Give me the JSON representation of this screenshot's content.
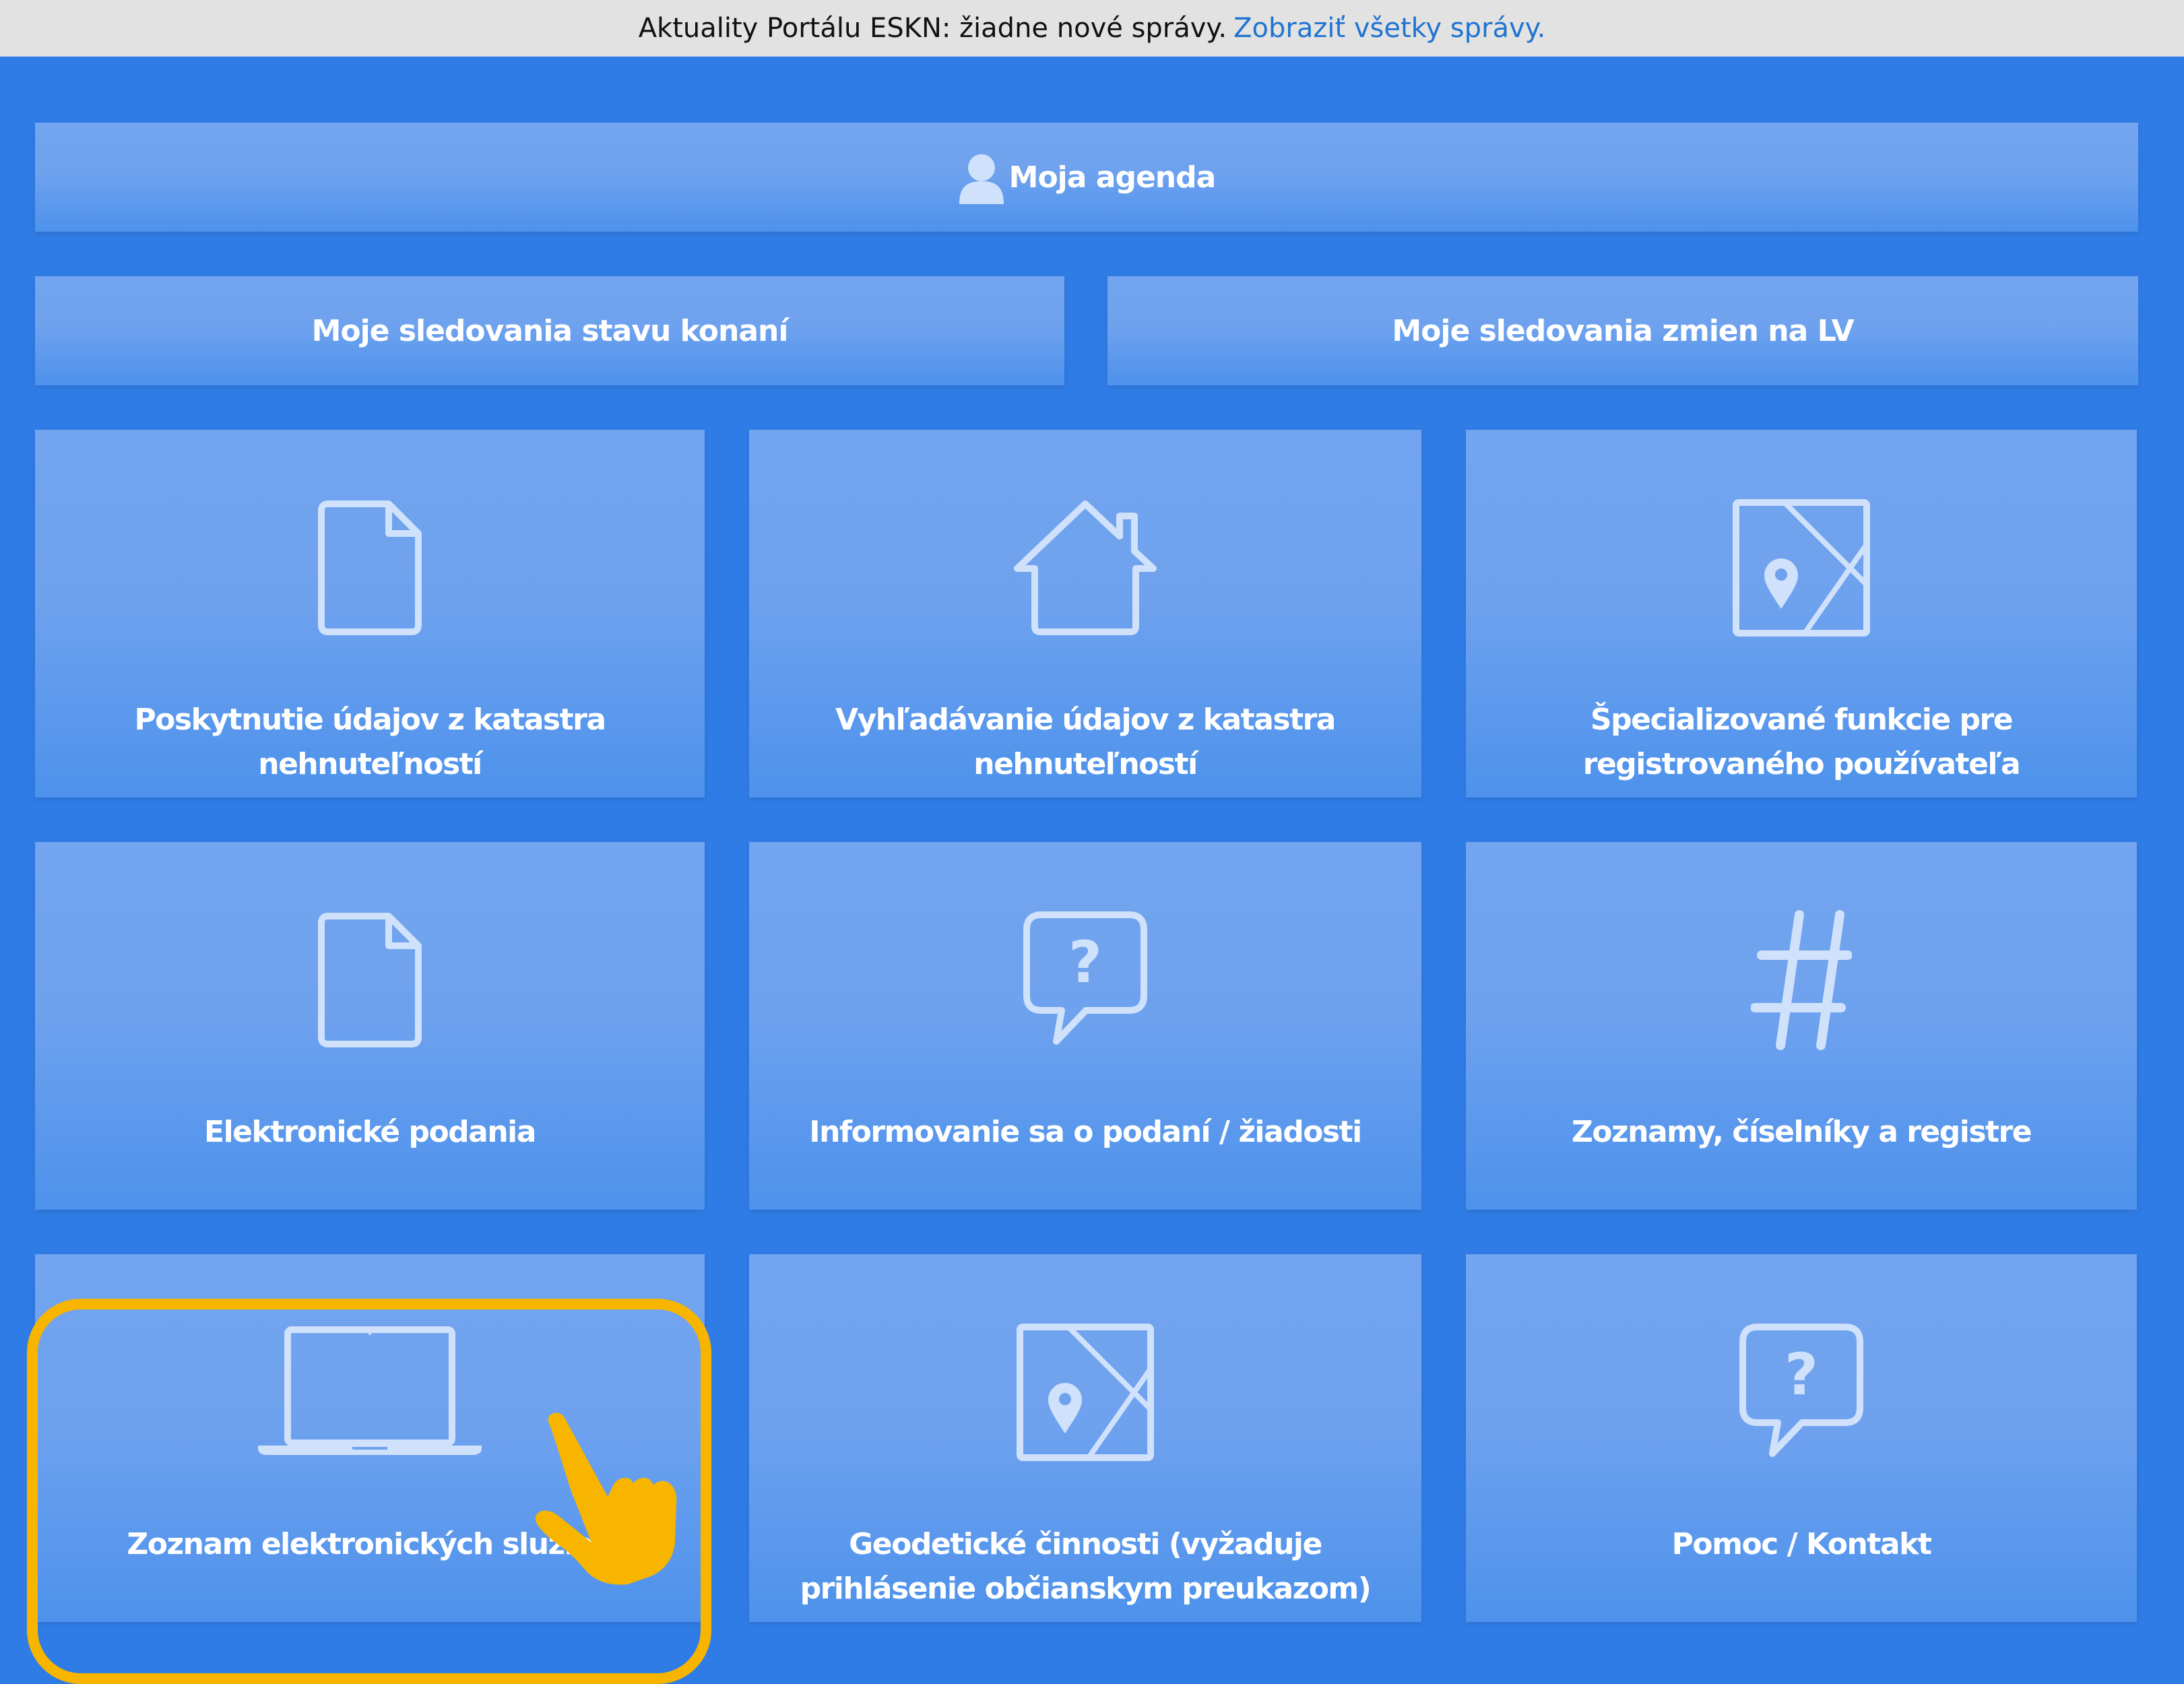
{
  "news_bar": {
    "text": "Aktuality Portálu ESKN: žiadne nové správy.",
    "link": "Zobraziť všetky správy."
  },
  "agenda": {
    "label": "Moja agenda"
  },
  "tracking": {
    "left": "Moje sledovania stavu konaní",
    "right": "Moje sledovania zmien na LV"
  },
  "tiles": [
    {
      "label": "Poskytnutie údajov z katastra nehnuteľností",
      "icon": "document-icon"
    },
    {
      "label": "Vyhľadávanie údajov z katastra nehnuteľností",
      "icon": "house-icon"
    },
    {
      "label": "Špecializované funkcie pre registrovaného používateľa",
      "icon": "map-pin-icon"
    },
    {
      "label": "Elektronické podania",
      "icon": "document-icon"
    },
    {
      "label": "Informovanie sa o podaní / žiadosti",
      "icon": "question-bubble-icon"
    },
    {
      "label": "Zoznamy, číselníky a registre",
      "icon": "hashtag-icon"
    },
    {
      "label": "Zoznam elektronických služieb",
      "icon": "laptop-icon"
    },
    {
      "label": "Geodetické činnosti (vyžaduje prihlásenie občianskym preukazom)",
      "icon": "map-pin-icon"
    },
    {
      "label": "Pomoc / Kontakt",
      "icon": "question-bubble-icon"
    }
  ],
  "colors": {
    "background": "#307ce6",
    "tile": "#6fa2ee",
    "icon_stroke": "#cfe1fb",
    "highlight": "#f7b500",
    "link": "#1f74d2"
  }
}
